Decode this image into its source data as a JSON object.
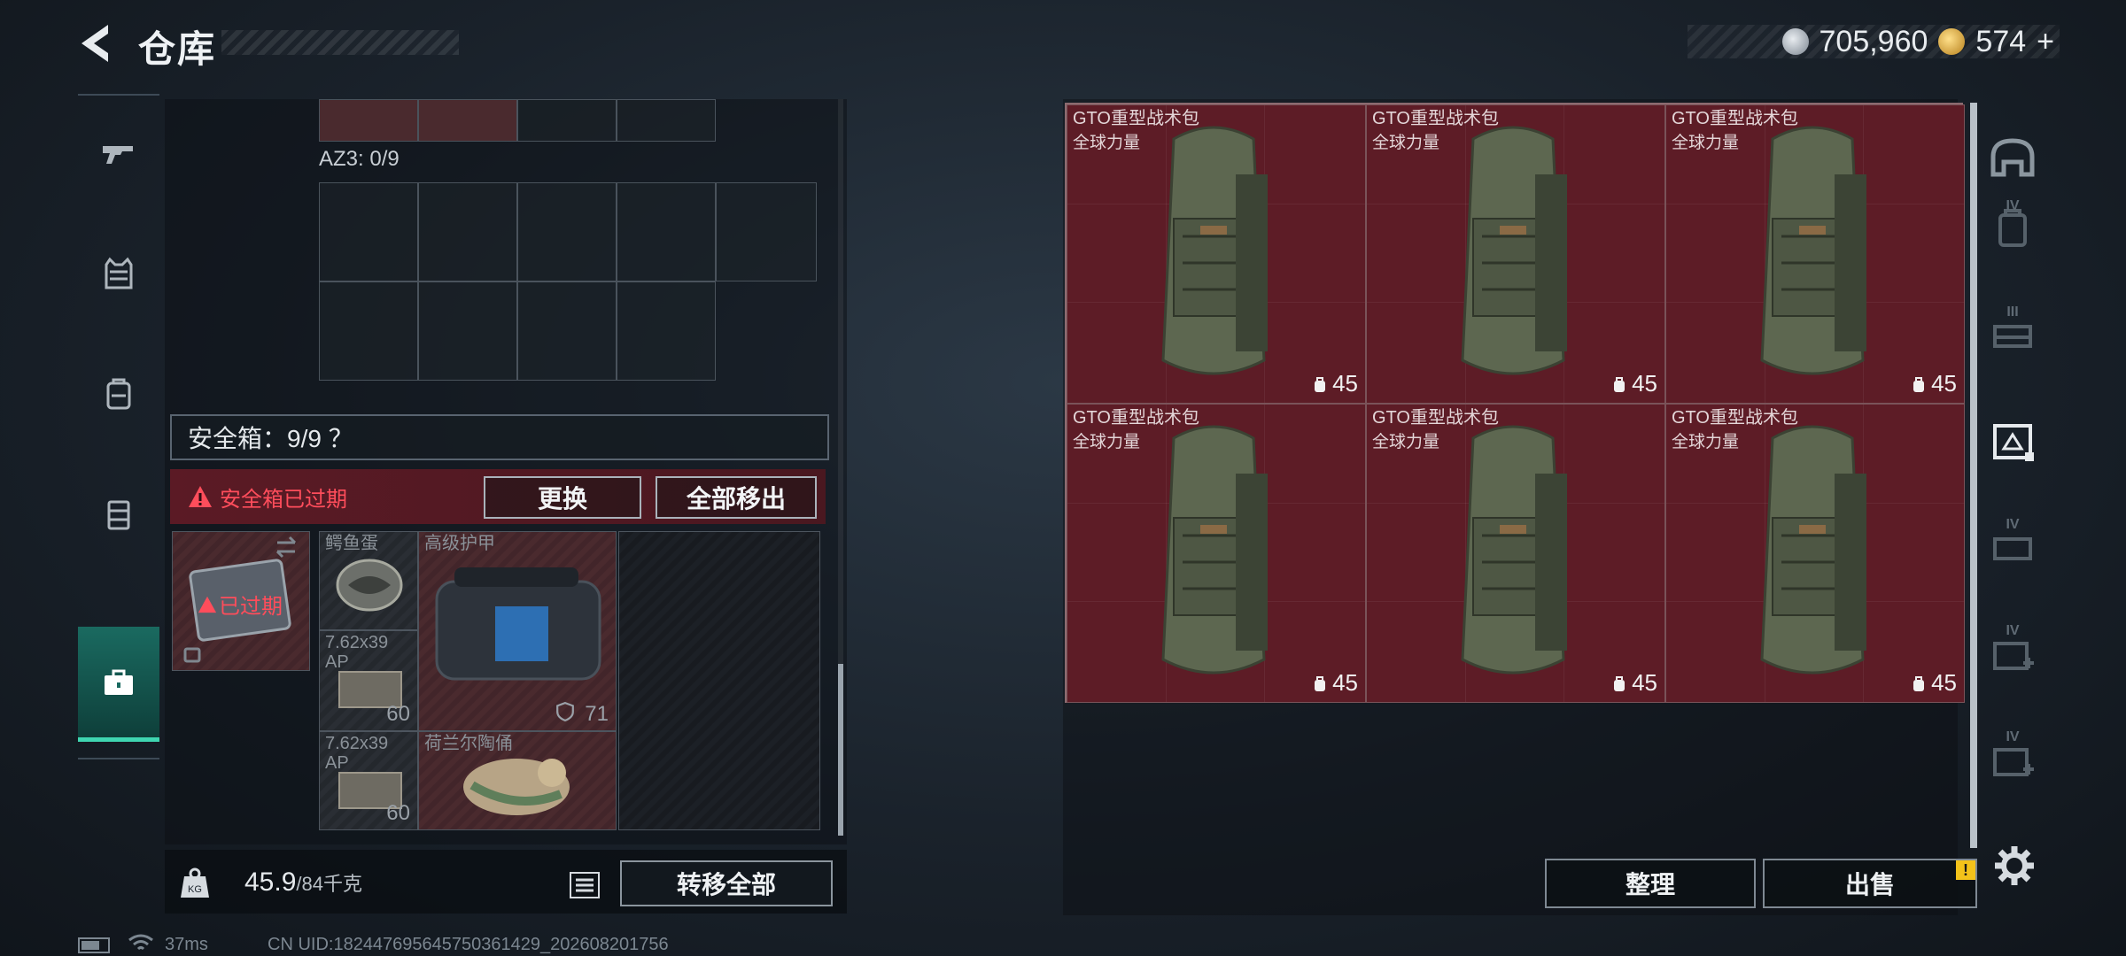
{
  "header": {
    "title": "仓库",
    "currency_silver": "705,960",
    "currency_gold": "574",
    "currency_gold_plus": "+"
  },
  "left_nav": {
    "items": [
      {
        "name": "weapon",
        "icon": "gun-icon"
      },
      {
        "name": "armor",
        "icon": "vest-icon"
      },
      {
        "name": "backpack",
        "icon": "backpack-icon"
      },
      {
        "name": "rig",
        "icon": "rig-icon"
      },
      {
        "name": "safebox",
        "icon": "toolbox-icon",
        "active": true
      }
    ]
  },
  "container": {
    "az3_label": "AZ3: 0/9"
  },
  "safebox": {
    "header": "安全箱：9/9 ？",
    "expired_alert": "安全箱已过期",
    "replace_label": "更换",
    "move_all_label": "全部移出",
    "box_status": "已过期",
    "items": [
      {
        "name": "鳄鱼蛋",
        "count": ""
      },
      {
        "name": "高级护甲",
        "count": "71"
      },
      {
        "name": "7.62x39 AP",
        "count": "60"
      },
      {
        "name": "7.62x39 AP",
        "count": "60"
      },
      {
        "name": "荷兰尔陶俑",
        "count": ""
      }
    ]
  },
  "footer_left": {
    "weight_current": "45.9",
    "weight_max": "/84千克",
    "transfer_all_label": "转移全部"
  },
  "status": {
    "ping": "37ms",
    "uid": "CN UID:182447695645750361429_202608201756"
  },
  "backpacks": [
    {
      "name": "GTO重型战术包",
      "sub": "全球力量",
      "capacity": "45"
    },
    {
      "name": "GTO重型战术包",
      "sub": "全球力量",
      "capacity": "45"
    },
    {
      "name": "GTO重型战术包",
      "sub": "全球力量",
      "capacity": "45"
    },
    {
      "name": "GTO重型战术包",
      "sub": "全球力量",
      "capacity": "45"
    },
    {
      "name": "GTO重型战术包",
      "sub": "全球力量",
      "capacity": "45"
    },
    {
      "name": "GTO重型战术包",
      "sub": "全球力量",
      "capacity": "45"
    }
  ],
  "categories": [
    {
      "roman": "",
      "icon": "helmet-icon"
    },
    {
      "roman": "IV",
      "icon": "backpack-category-icon"
    },
    {
      "roman": "III",
      "icon": "rig-category-icon"
    },
    {
      "roman": "",
      "icon": "backpack-selected-icon",
      "active": true
    },
    {
      "roman": "IV",
      "icon": "rig-iv-icon"
    },
    {
      "roman": "IV",
      "icon": "medical-icon"
    },
    {
      "roman": "IV",
      "icon": "medical-plus-icon"
    }
  ],
  "right_actions": {
    "sort_label": "整理",
    "sell_label": "出售",
    "warn_badge": "!"
  },
  "colors": {
    "accent": "#3fd6b1",
    "alert": "#ff4d5b",
    "backpack_bg": "#5d1c26",
    "warn": "#f3c21a"
  }
}
